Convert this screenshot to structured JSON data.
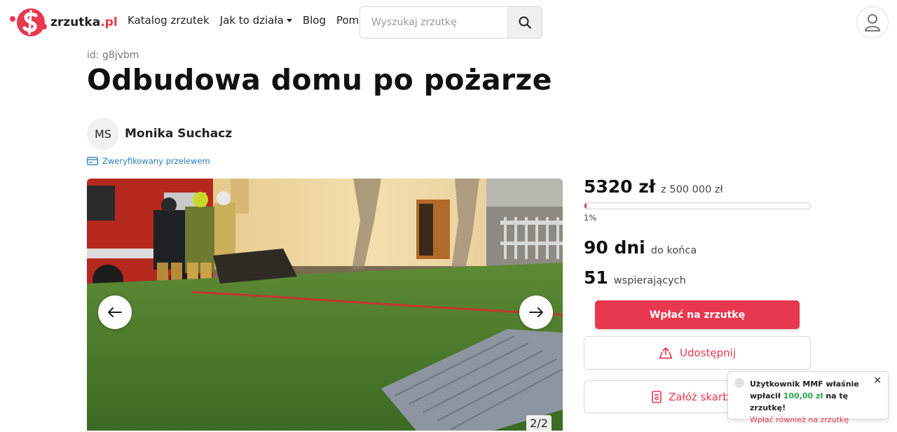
{
  "header": {
    "logo_text": "zrzutka",
    "logo_tld": ".pl",
    "nav": {
      "catalog": "Katalog zrzutek",
      "how_it_works": "Jak to działa",
      "blog": "Blog",
      "help": "Pomoc"
    },
    "search_placeholder": "Wyszukaj zrzutkę",
    "icons": {
      "search": "search-icon",
      "user": "user-icon",
      "dropdown": "caret-down-icon"
    }
  },
  "fundraiser": {
    "id_label": "id: g8jvbm",
    "title": "Odbudowa domu po pożarze",
    "author_initials": "MS",
    "author_name": "Monika Suchacz",
    "verified_label": "Zweryfikowany przelewem",
    "gallery_counter": "2/2"
  },
  "stats": {
    "raised": "5320 zł",
    "goal": "z 500 000 zł",
    "progress_fraction": 0.0106,
    "percent_label": "1%",
    "days": "90 dni",
    "days_suffix": "do końca",
    "supporters": "51",
    "supporters_suffix": "wspierających"
  },
  "actions": {
    "pay": "Wpłać na zrzutkę",
    "share": "Udostępnij",
    "piggy": "Załóż skarbonkę"
  },
  "toast": {
    "line1": "Użytkownik MMF właśnie",
    "line2_prefix": "wpłacił ",
    "amount": "100,00 zł",
    "line2_suffix": " na tę zrzutkę!",
    "link": "Wpłać również na zrzutkę",
    "close": "✕"
  },
  "colors": {
    "accent": "#e8384f",
    "link": "#2a7ab8",
    "success": "#2aa24a"
  }
}
